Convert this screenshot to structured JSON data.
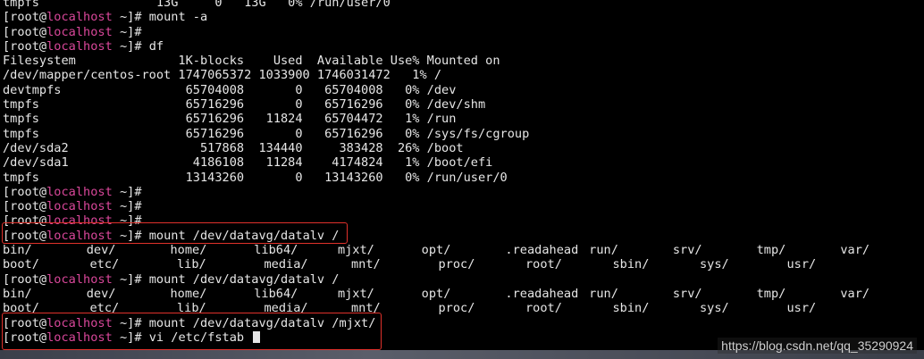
{
  "terminal": {
    "lines": [
      {
        "type": "text",
        "text": "tmpfs                13G     0   13G   0% /run/user/0"
      },
      {
        "type": "prompt",
        "user": "[root@",
        "host": "localhost",
        "rest": " ~]# mount -a"
      },
      {
        "type": "prompt",
        "user": "[root@",
        "host": "localhost",
        "rest": " ~]#"
      },
      {
        "type": "prompt",
        "user": "[root@",
        "host": "localhost",
        "rest": " ~]# df"
      },
      {
        "type": "text",
        "text": "Filesystem              1K-blocks    Used  Available Use% Mounted on"
      },
      {
        "type": "text",
        "text": "/dev/mapper/centos-root 1747065372 1033900 1746031472   1% /"
      },
      {
        "type": "text",
        "text": "devtmpfs                 65704008       0   65704008   0% /dev"
      },
      {
        "type": "text",
        "text": "tmpfs                    65716296       0   65716296   0% /dev/shm"
      },
      {
        "type": "text",
        "text": "tmpfs                    65716296   11824   65704472   1% /run"
      },
      {
        "type": "text",
        "text": "tmpfs                    65716296       0   65716296   0% /sys/fs/cgroup"
      },
      {
        "type": "text",
        "text": "/dev/sda2                  517868  134440     383428  26% /boot"
      },
      {
        "type": "text",
        "text": "/dev/sda1                 4186108   11284    4174824   1% /boot/efi"
      },
      {
        "type": "text",
        "text": "tmpfs                    13143260       0   13143260   0% /run/user/0"
      },
      {
        "type": "prompt",
        "user": "[root@",
        "host": "localhost",
        "rest": " ~]#"
      },
      {
        "type": "prompt",
        "user": "[root@",
        "host": "localhost",
        "rest": " ~]#"
      },
      {
        "type": "prompt",
        "user": "[root@",
        "host": "localhost",
        "rest": " ~]#"
      },
      {
        "type": "prompt",
        "user": "[root@",
        "host": "localhost",
        "rest": " ~]# mount /dev/datavg/datalv /"
      },
      {
        "type": "cols",
        "items": [
          "bin/",
          "dev/",
          "home/",
          "lib64/",
          "mjxt/",
          "opt/",
          ".readahead",
          "run/",
          "srv/",
          "tmp/",
          "var/"
        ]
      },
      {
        "type": "cols",
        "items": [
          "boot/",
          "etc/",
          "lib/",
          "media/",
          "mnt/",
          "proc/",
          "root/",
          "sbin/",
          "sys/",
          "usr/"
        ]
      },
      {
        "type": "prompt",
        "user": "[root@",
        "host": "localhost",
        "rest": " ~]# mount /dev/datavg/datalv /"
      },
      {
        "type": "cols",
        "items": [
          "bin/",
          "dev/",
          "home/",
          "lib64/",
          "mjxt/",
          "opt/",
          ".readahead",
          "run/",
          "srv/",
          "tmp/",
          "var/"
        ]
      },
      {
        "type": "cols",
        "items": [
          "boot/",
          "etc/",
          "lib/",
          "media/",
          "mnt/",
          "proc/",
          "root/",
          "sbin/",
          "sys/",
          "usr/"
        ]
      },
      {
        "type": "prompt",
        "user": "[root@",
        "host": "localhost",
        "rest": " ~]# mount /dev/datavg/datalv /mjxt/"
      },
      {
        "type": "prompt",
        "user": "[root@",
        "host": "localhost",
        "rest": " ~]# vi /etc/fstab ",
        "cursor": true
      }
    ]
  },
  "watermark": "https://blog.csdn.net/qq_35290924",
  "colors": {
    "background": "#000000",
    "text": "#e6e6e6",
    "host": "#d9479a",
    "highlight": "#e0312b"
  }
}
